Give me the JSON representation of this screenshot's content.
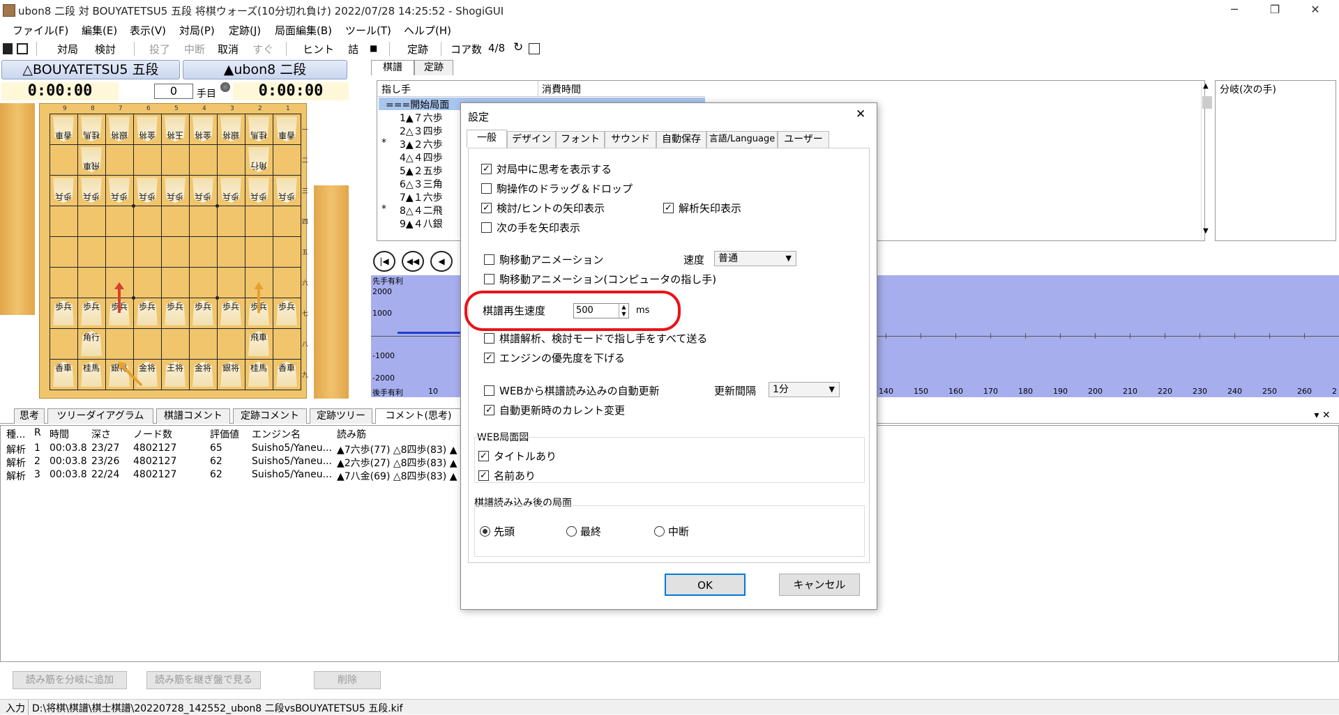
{
  "window": {
    "title": "ubon8 二段 対 BOUYATETSU5 五段 将棋ウォーズ(10分切れ負け) 2022/07/28 14:25:52 - ShogiGUI",
    "minimize": "─",
    "restore": "❐",
    "close": "✕"
  },
  "menu": [
    "ファイル(F)",
    "編集(E)",
    "表示(V)",
    "対局(P)",
    "定跡(J)",
    "局面編集(B)",
    "ツール(T)",
    "ヘルプ(H)"
  ],
  "toolbar": {
    "game": "対局",
    "study": "検討",
    "resign": "投了",
    "interrupt": "中断",
    "cancel": "取消",
    "immediate": "すぐ",
    "hint": "ヒント",
    "mate": "詰",
    "stop": "■",
    "joseki": "定跡",
    "cores_label": "コア数",
    "cores_value": "4/8"
  },
  "players": {
    "gote_name": "△BOUYATETSU5 五段",
    "sente_name": "▲ubon8 二段",
    "gote_time": "0:00:00",
    "sente_time": "0:00:00",
    "move_no": "0",
    "move_suffix": "手目"
  },
  "board": {
    "files": [
      "9",
      "8",
      "7",
      "6",
      "5",
      "4",
      "3",
      "2",
      "1"
    ],
    "ranks": [
      "一",
      "二",
      "三",
      "四",
      "五",
      "六",
      "七",
      "八",
      "九"
    ],
    "gote_rank1": [
      "香車",
      "桂馬",
      "銀将",
      "金将",
      "玉将",
      "金将",
      "銀将",
      "桂馬",
      "香車"
    ],
    "gote_rook": "飛車",
    "gote_bishop": "角行",
    "gote_pawn": "歩兵",
    "sente_pawn": "歩兵",
    "sente_bishop": "角行",
    "sente_rook": "飛車",
    "sente_rank9": [
      "香車",
      "桂馬",
      "銀将",
      "金将",
      "王将",
      "金将",
      "銀将",
      "桂馬",
      "香車"
    ]
  },
  "kifu": {
    "tabs": [
      "棋譜",
      "定跡"
    ],
    "col_move": "指し手",
    "col_time": "消費時間",
    "moves": [
      {
        "mark": "",
        "text": "===開始局面"
      },
      {
        "mark": "",
        "text": "1▲７六歩"
      },
      {
        "mark": "",
        "text": "2△３四歩"
      },
      {
        "mark": "*",
        "text": "3▲２六歩"
      },
      {
        "mark": "",
        "text": "4△４四歩"
      },
      {
        "mark": "",
        "text": "5▲２五歩"
      },
      {
        "mark": "",
        "text": "6△３三角"
      },
      {
        "mark": "",
        "text": "7▲１六歩"
      },
      {
        "mark": "*",
        "text": "8△４二飛"
      },
      {
        "mark": "",
        "text": "9▲４八銀"
      }
    ],
    "branch_title": "分岐(次の手)"
  },
  "graph": {
    "top_label": "先手有利",
    "bottom_label": "後手有利",
    "y_ticks": [
      "2000",
      "1000",
      "-1000",
      "-2000"
    ],
    "x_first": "10",
    "x_ticks": [
      "140",
      "150",
      "160",
      "170",
      "180",
      "190",
      "200",
      "210",
      "220",
      "230",
      "240",
      "250",
      "260",
      "2"
    ]
  },
  "bottom": {
    "tabs": [
      "思考",
      "ツリーダイアグラム",
      "棋譜コメント",
      "定跡コメント",
      "定跡ツリー",
      "コメント(思考)"
    ],
    "pane_controls": "▾ ✕",
    "headers": [
      "種...",
      "R",
      "時間",
      "深さ",
      "ノード数",
      "評価値",
      "エンジン名",
      "読み筋"
    ],
    "rows": [
      [
        "解析",
        "1",
        "00:03.8",
        "23/27",
        "4802127",
        "65",
        "Suisho5/Yaneu...",
        "▲7六歩(77) △8四歩(83) ▲"
      ],
      [
        "解析",
        "2",
        "00:03.8",
        "23/26",
        "4802127",
        "62",
        "Suisho5/Yaneu...",
        "▲2六歩(27) △8四歩(83) ▲"
      ],
      [
        "解析",
        "3",
        "00:03.8",
        "22/24",
        "4802127",
        "62",
        "Suisho5/Yaneu...",
        "▲7八金(69) △8四歩(83) ▲"
      ]
    ],
    "btn_add_branch": "読み筋を分岐に追加",
    "btn_view_board": "読み筋を継ぎ盤で見る",
    "btn_delete": "削除"
  },
  "status": {
    "mode": "入力",
    "path": "D:\\将棋\\棋譜\\棋士棋譜\\20220728_142552_ubon8 二段vsBOUYATETSU5 五段.kif"
  },
  "dialog": {
    "title": "設定",
    "close": "✕",
    "tabs": [
      "一般",
      "デザイン",
      "フォント",
      "サウンド",
      "自動保存",
      "言語/Language",
      "ユーザー"
    ],
    "opt_show_thinking": "対局中に思考を表示する",
    "opt_drag_drop": "駒操作のドラッグ＆ドロップ",
    "opt_hint_arrow": "検討/ヒントの矢印表示",
    "opt_analysis_arrow": "解析矢印表示",
    "opt_next_arrow": "次の手を矢印表示",
    "opt_anim": "駒移動アニメーション",
    "speed_label": "速度",
    "speed_value": "普通",
    "opt_anim_cpu": "駒移動アニメーション(コンピュータの指し手)",
    "replay_label": "棋譜再生速度",
    "replay_value": "500",
    "replay_unit": "ms",
    "opt_send_all": "棋譜解析、検討モードで指し手をすべて送る",
    "opt_lower_priority": "エンジンの優先度を下げる",
    "opt_web_update": "WEBから棋譜読み込みの自動更新",
    "interval_label": "更新間隔",
    "interval_value": "1分",
    "opt_current_change": "自動更新時のカレント変更",
    "web_group": "WEB局面図",
    "opt_title": "タイトルあり",
    "opt_names": "名前あり",
    "after_load_group": "棋譜読み込み後の局面",
    "radio_first": "先頭",
    "radio_last": "最終",
    "radio_mid": "中断",
    "ok": "OK",
    "cancel": "キャンセル",
    "highlight_color": "#e8141a"
  }
}
